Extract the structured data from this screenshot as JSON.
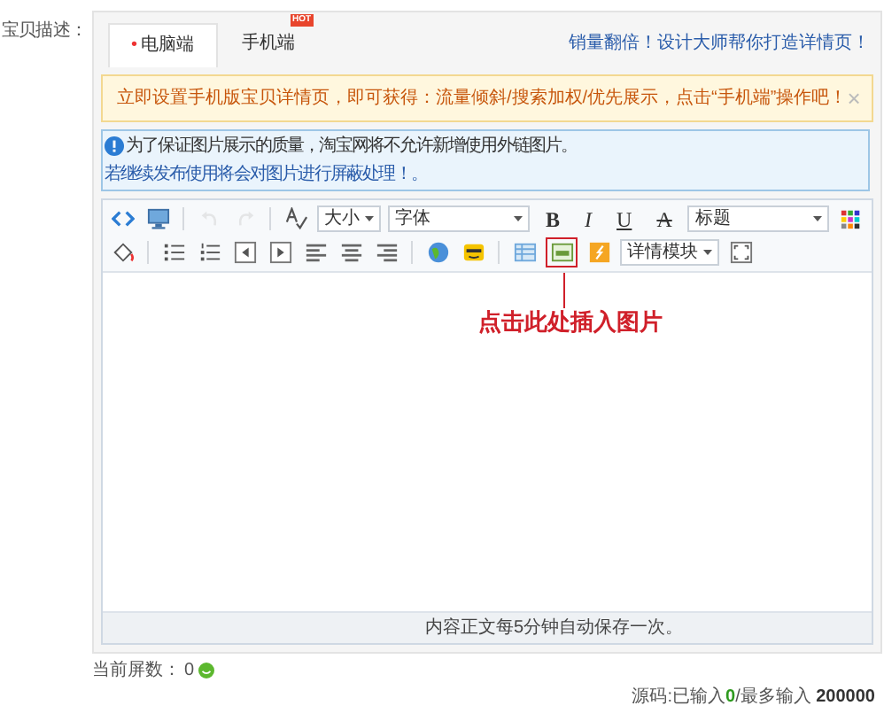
{
  "field_label": "宝贝描述：",
  "tabs": [
    {
      "label": "电脑端",
      "selected": true,
      "required_mark": "•"
    },
    {
      "label": "手机端",
      "selected": false,
      "badge": "HOT"
    }
  ],
  "promo_link": "销量翻倍！设计大师帮你打造详情页！",
  "notice": {
    "text": "立即设置手机版宝贝详情页，即可获得：流量倾斜/搜索加权/优先展示，点击“手机端”操作吧！",
    "close": "×"
  },
  "info": {
    "text": "为了保证图片展示的质量，淘宝网将不允许新增使用外链图片。",
    "link": "若继续发布使用将会对图片进行屏蔽处理！。"
  },
  "toolbar": {
    "rows": [
      [
        {
          "kind": "icon",
          "disabled": false
        },
        {
          "kind": "icon",
          "disabled": false
        },
        {
          "kind": "separator"
        },
        {
          "kind": "icon",
          "disabled": true
        },
        {
          "kind": "icon",
          "disabled": true
        },
        {
          "kind": "separator"
        },
        {
          "kind": "icon",
          "disabled": false
        },
        {
          "kind": "dropdown",
          "label": "大小"
        },
        {
          "kind": "dropdown",
          "label": "字体",
          "wide": true
        },
        {
          "kind": "glyph",
          "label": "B"
        },
        {
          "kind": "glyph",
          "label": "I"
        },
        {
          "kind": "glyph",
          "label": "U"
        },
        {
          "kind": "glyph",
          "label": "A"
        },
        {
          "kind": "dropdown",
          "label": "标题",
          "wide": true
        },
        {
          "kind": "icon",
          "disabled": false
        }
      ],
      [
        {
          "kind": "icon",
          "disabled": false
        },
        {
          "kind": "separator"
        },
        {
          "kind": "icon",
          "disabled": false
        },
        {
          "kind": "icon",
          "disabled": false
        },
        {
          "kind": "icon",
          "disabled": false
        },
        {
          "kind": "icon",
          "disabled": false
        },
        {
          "kind": "icon",
          "disabled": false
        },
        {
          "kind": "icon",
          "disabled": false
        },
        {
          "kind": "icon",
          "disabled": false
        },
        {
          "kind": "separator"
        },
        {
          "kind": "icon",
          "disabled": false
        },
        {
          "kind": "icon",
          "disabled": false
        },
        {
          "kind": "separator"
        },
        {
          "kind": "icon",
          "disabled": false
        },
        {
          "kind": "icon",
          "disabled": false,
          "highlighted": true
        },
        {
          "kind": "icon",
          "disabled": false
        },
        {
          "kind": "dropdown",
          "label": "详情模块"
        },
        {
          "kind": "icon",
          "disabled": false
        }
      ]
    ]
  },
  "annotation": "点击此处插入图片",
  "status_bar": "内容正文每5分钟自动保存一次。",
  "screen_count": {
    "label": "当前屏数：",
    "value": "0"
  },
  "source_counter": "源码:已输入**0**/最多输入 **200000**"
}
